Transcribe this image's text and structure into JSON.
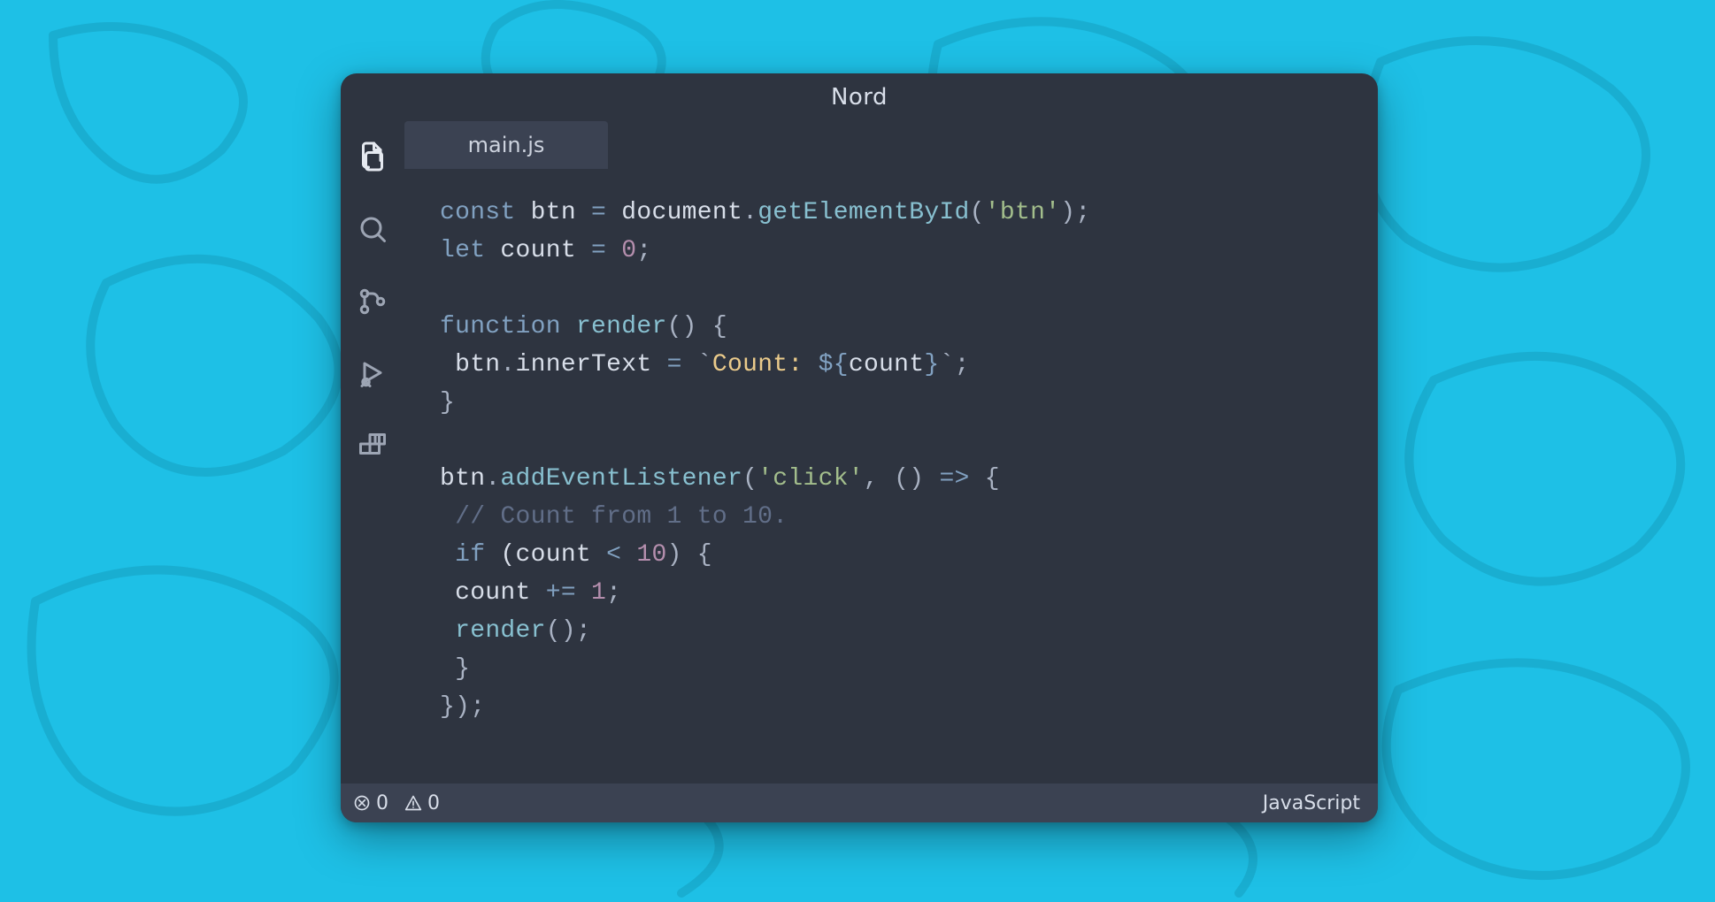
{
  "theme_name": "Nord",
  "titlebar": {
    "title": "Nord"
  },
  "activity_bar": {
    "items": [
      {
        "name": "explorer-icon",
        "label": "Explorer"
      },
      {
        "name": "search-icon",
        "label": "Search"
      },
      {
        "name": "source-control-icon",
        "label": "Source Control"
      },
      {
        "name": "run-debug-icon",
        "label": "Run and Debug"
      },
      {
        "name": "extensions-icon",
        "label": "Extensions"
      }
    ]
  },
  "tabs": [
    {
      "label": "main.js",
      "active": true
    }
  ],
  "statusbar": {
    "errors": "0",
    "warnings": "0",
    "language": "JavaScript"
  },
  "colors": {
    "bg": "#2e3440",
    "panel": "#3b4252",
    "text": "#d8dee9",
    "keyword": "#81a1c1",
    "function": "#88c0d0",
    "string": "#a3be8c",
    "number": "#b48ead",
    "comment": "#616e88",
    "template": "#ebcb8b",
    "page_bg": "#1ec0e6",
    "page_bg_stroke": "#19aed1"
  },
  "code": {
    "filename": "main.js",
    "language": "JavaScript",
    "lines": [
      {
        "tokens": [
          {
            "t": "const ",
            "c": "kw"
          },
          {
            "t": "btn ",
            "c": "ident"
          },
          {
            "t": "= ",
            "c": "op"
          },
          {
            "t": "document",
            "c": "ident"
          },
          {
            "t": ".",
            "c": "punct"
          },
          {
            "t": "getElementById",
            "c": "func"
          },
          {
            "t": "(",
            "c": "punct"
          },
          {
            "t": "'btn'",
            "c": "str"
          },
          {
            "t": ");",
            "c": "punct"
          }
        ]
      },
      {
        "tokens": [
          {
            "t": "let ",
            "c": "kw"
          },
          {
            "t": "count ",
            "c": "ident"
          },
          {
            "t": "= ",
            "c": "op"
          },
          {
            "t": "0",
            "c": "num"
          },
          {
            "t": ";",
            "c": "punct"
          }
        ]
      },
      {
        "tokens": []
      },
      {
        "tokens": [
          {
            "t": "function ",
            "c": "kw"
          },
          {
            "t": "render",
            "c": "func"
          },
          {
            "t": "() {",
            "c": "punct"
          }
        ]
      },
      {
        "tokens": [
          {
            "t": " btn",
            "c": "ident"
          },
          {
            "t": ".",
            "c": "punct"
          },
          {
            "t": "innerText ",
            "c": "ident"
          },
          {
            "t": "= ",
            "c": "op"
          },
          {
            "t": "`",
            "c": "punct"
          },
          {
            "t": "Count: ",
            "c": "templit"
          },
          {
            "t": "${",
            "c": "brace"
          },
          {
            "t": "count",
            "c": "ident"
          },
          {
            "t": "}",
            "c": "brace"
          },
          {
            "t": "`",
            "c": "punct"
          },
          {
            "t": ";",
            "c": "punct"
          }
        ]
      },
      {
        "tokens": [
          {
            "t": "}",
            "c": "punct"
          }
        ]
      },
      {
        "tokens": []
      },
      {
        "tokens": [
          {
            "t": "btn",
            "c": "ident"
          },
          {
            "t": ".",
            "c": "punct"
          },
          {
            "t": "addEventListener",
            "c": "func"
          },
          {
            "t": "(",
            "c": "punct"
          },
          {
            "t": "'click'",
            "c": "str"
          },
          {
            "t": ", () ",
            "c": "punct"
          },
          {
            "t": "=>",
            "c": "op"
          },
          {
            "t": " {",
            "c": "punct"
          }
        ]
      },
      {
        "tokens": [
          {
            "t": " ",
            "c": "punct"
          },
          {
            "t": "// Count from 1 to 10.",
            "c": "cmt"
          }
        ]
      },
      {
        "tokens": [
          {
            "t": " ",
            "c": "punct"
          },
          {
            "t": "if ",
            "c": "kw"
          },
          {
            "t": "(count ",
            "c": "ident"
          },
          {
            "t": "< ",
            "c": "op"
          },
          {
            "t": "10",
            "c": "num"
          },
          {
            "t": ") {",
            "c": "punct"
          }
        ]
      },
      {
        "tokens": [
          {
            "t": " count ",
            "c": "ident"
          },
          {
            "t": "+= ",
            "c": "op"
          },
          {
            "t": "1",
            "c": "num"
          },
          {
            "t": ";",
            "c": "punct"
          }
        ]
      },
      {
        "tokens": [
          {
            "t": " ",
            "c": "punct"
          },
          {
            "t": "render",
            "c": "func"
          },
          {
            "t": "();",
            "c": "punct"
          }
        ]
      },
      {
        "tokens": [
          {
            "t": " }",
            "c": "punct"
          }
        ]
      },
      {
        "tokens": [
          {
            "t": "});",
            "c": "punct"
          }
        ]
      }
    ]
  }
}
